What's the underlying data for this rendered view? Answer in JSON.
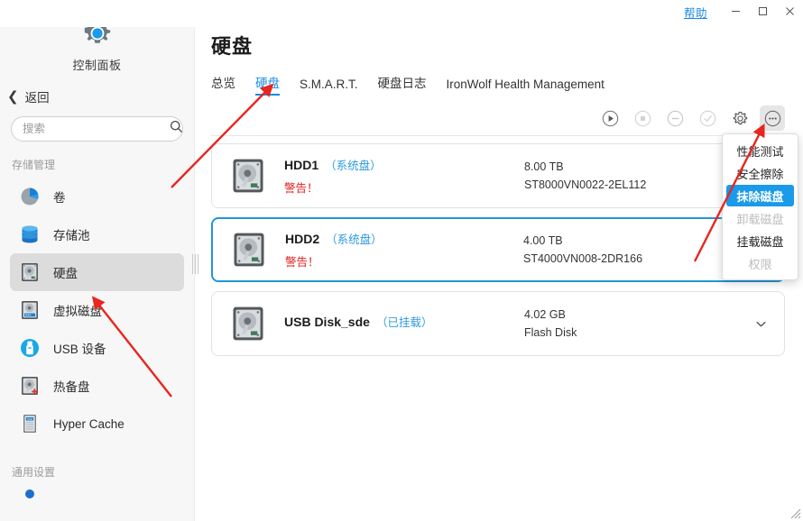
{
  "titlebar": {
    "help_label": "帮助",
    "minimize_icon": "minimize-icon",
    "maximize_icon": "maximize-icon",
    "close_icon": "close-icon"
  },
  "sidebar": {
    "app_title": "控制面板",
    "app_icon": "gear-icon",
    "back_label": "返回",
    "back_icon": "chevron-left-icon",
    "search": {
      "value": "",
      "placeholder": "搜索",
      "icon": "search-icon"
    },
    "sections": [
      {
        "label": "存储管理",
        "items": [
          {
            "label": "卷",
            "icon": "volume-pie-icon",
            "active": false
          },
          {
            "label": "存储池",
            "icon": "storage-pool-icon",
            "active": false
          },
          {
            "label": "硬盘",
            "icon": "hard-disk-icon",
            "active": true
          },
          {
            "label": "虚拟磁盘",
            "icon": "virtual-disk-icon",
            "active": false
          },
          {
            "label": "USB 设备",
            "icon": "usb-device-icon",
            "active": false
          },
          {
            "label": "热备盘",
            "icon": "hot-spare-icon",
            "active": false
          },
          {
            "label": "Hyper Cache",
            "icon": "hyper-cache-icon",
            "active": false
          }
        ]
      },
      {
        "label": "通用设置",
        "items": []
      }
    ]
  },
  "main": {
    "page_title": "硬盘",
    "tabs": [
      {
        "label": "总览",
        "active": false
      },
      {
        "label": "硬盘",
        "active": true
      },
      {
        "label": "S.M.A.R.T.",
        "active": false
      },
      {
        "label": "硬盘日志",
        "active": false
      },
      {
        "label": "IronWolf Health Management",
        "active": false
      }
    ],
    "toolbar": [
      {
        "name": "play-button",
        "icon": "play-circle-icon",
        "disabled": false,
        "active": false
      },
      {
        "name": "stop-button",
        "icon": "stop-circle-icon",
        "disabled": true,
        "active": false
      },
      {
        "name": "remove-button",
        "icon": "minus-circle-icon",
        "disabled": true,
        "active": false
      },
      {
        "name": "check-button",
        "icon": "check-circle-icon",
        "disabled": true,
        "active": false
      },
      {
        "name": "settings-button",
        "icon": "gear-circle-icon",
        "disabled": false,
        "active": false
      },
      {
        "name": "more-button",
        "icon": "ellipsis-circle-icon",
        "disabled": false,
        "active": true
      }
    ],
    "disks": [
      {
        "name": "HDD1",
        "tag": "（系统盘）",
        "status": "警告！",
        "status_warning": true,
        "capacity": "8.00 TB",
        "model": "ST8000VN0022-2EL112",
        "selected": false,
        "has_chevron": false
      },
      {
        "name": "HDD2",
        "tag": "（系统盘）",
        "status": "警告！",
        "status_warning": true,
        "capacity": "4.00 TB",
        "model": "ST4000VN008-2DR166",
        "selected": true,
        "has_chevron": false
      },
      {
        "name": "USB Disk_sde",
        "tag": "（已挂载）",
        "status": "",
        "status_warning": false,
        "capacity": "4.02 GB",
        "model": "Flash Disk",
        "selected": false,
        "has_chevron": true
      }
    ]
  },
  "context_menu": {
    "items": [
      {
        "label": "性能测试",
        "highlighted": false,
        "disabled": false
      },
      {
        "label": "安全擦除",
        "highlighted": false,
        "disabled": false
      },
      {
        "label": "抹除磁盘",
        "highlighted": true,
        "disabled": false
      },
      {
        "label": "卸载磁盘",
        "highlighted": false,
        "disabled": true
      },
      {
        "label": "挂载磁盘",
        "highlighted": false,
        "disabled": false
      },
      {
        "label": "权限",
        "highlighted": false,
        "disabled": true
      }
    ]
  },
  "colors": {
    "accent_blue": "#1a8ae0",
    "menu_highlight": "#1a9ae8",
    "selected_border": "#2196d6",
    "warning_red": "#e02020",
    "annotation_red": "#e8251f",
    "sidebar_bg": "#f7f7f7",
    "nav_active_bg": "#dcdcdc"
  },
  "annotations": {
    "arrow_count": 3,
    "color": "#e8251f"
  }
}
